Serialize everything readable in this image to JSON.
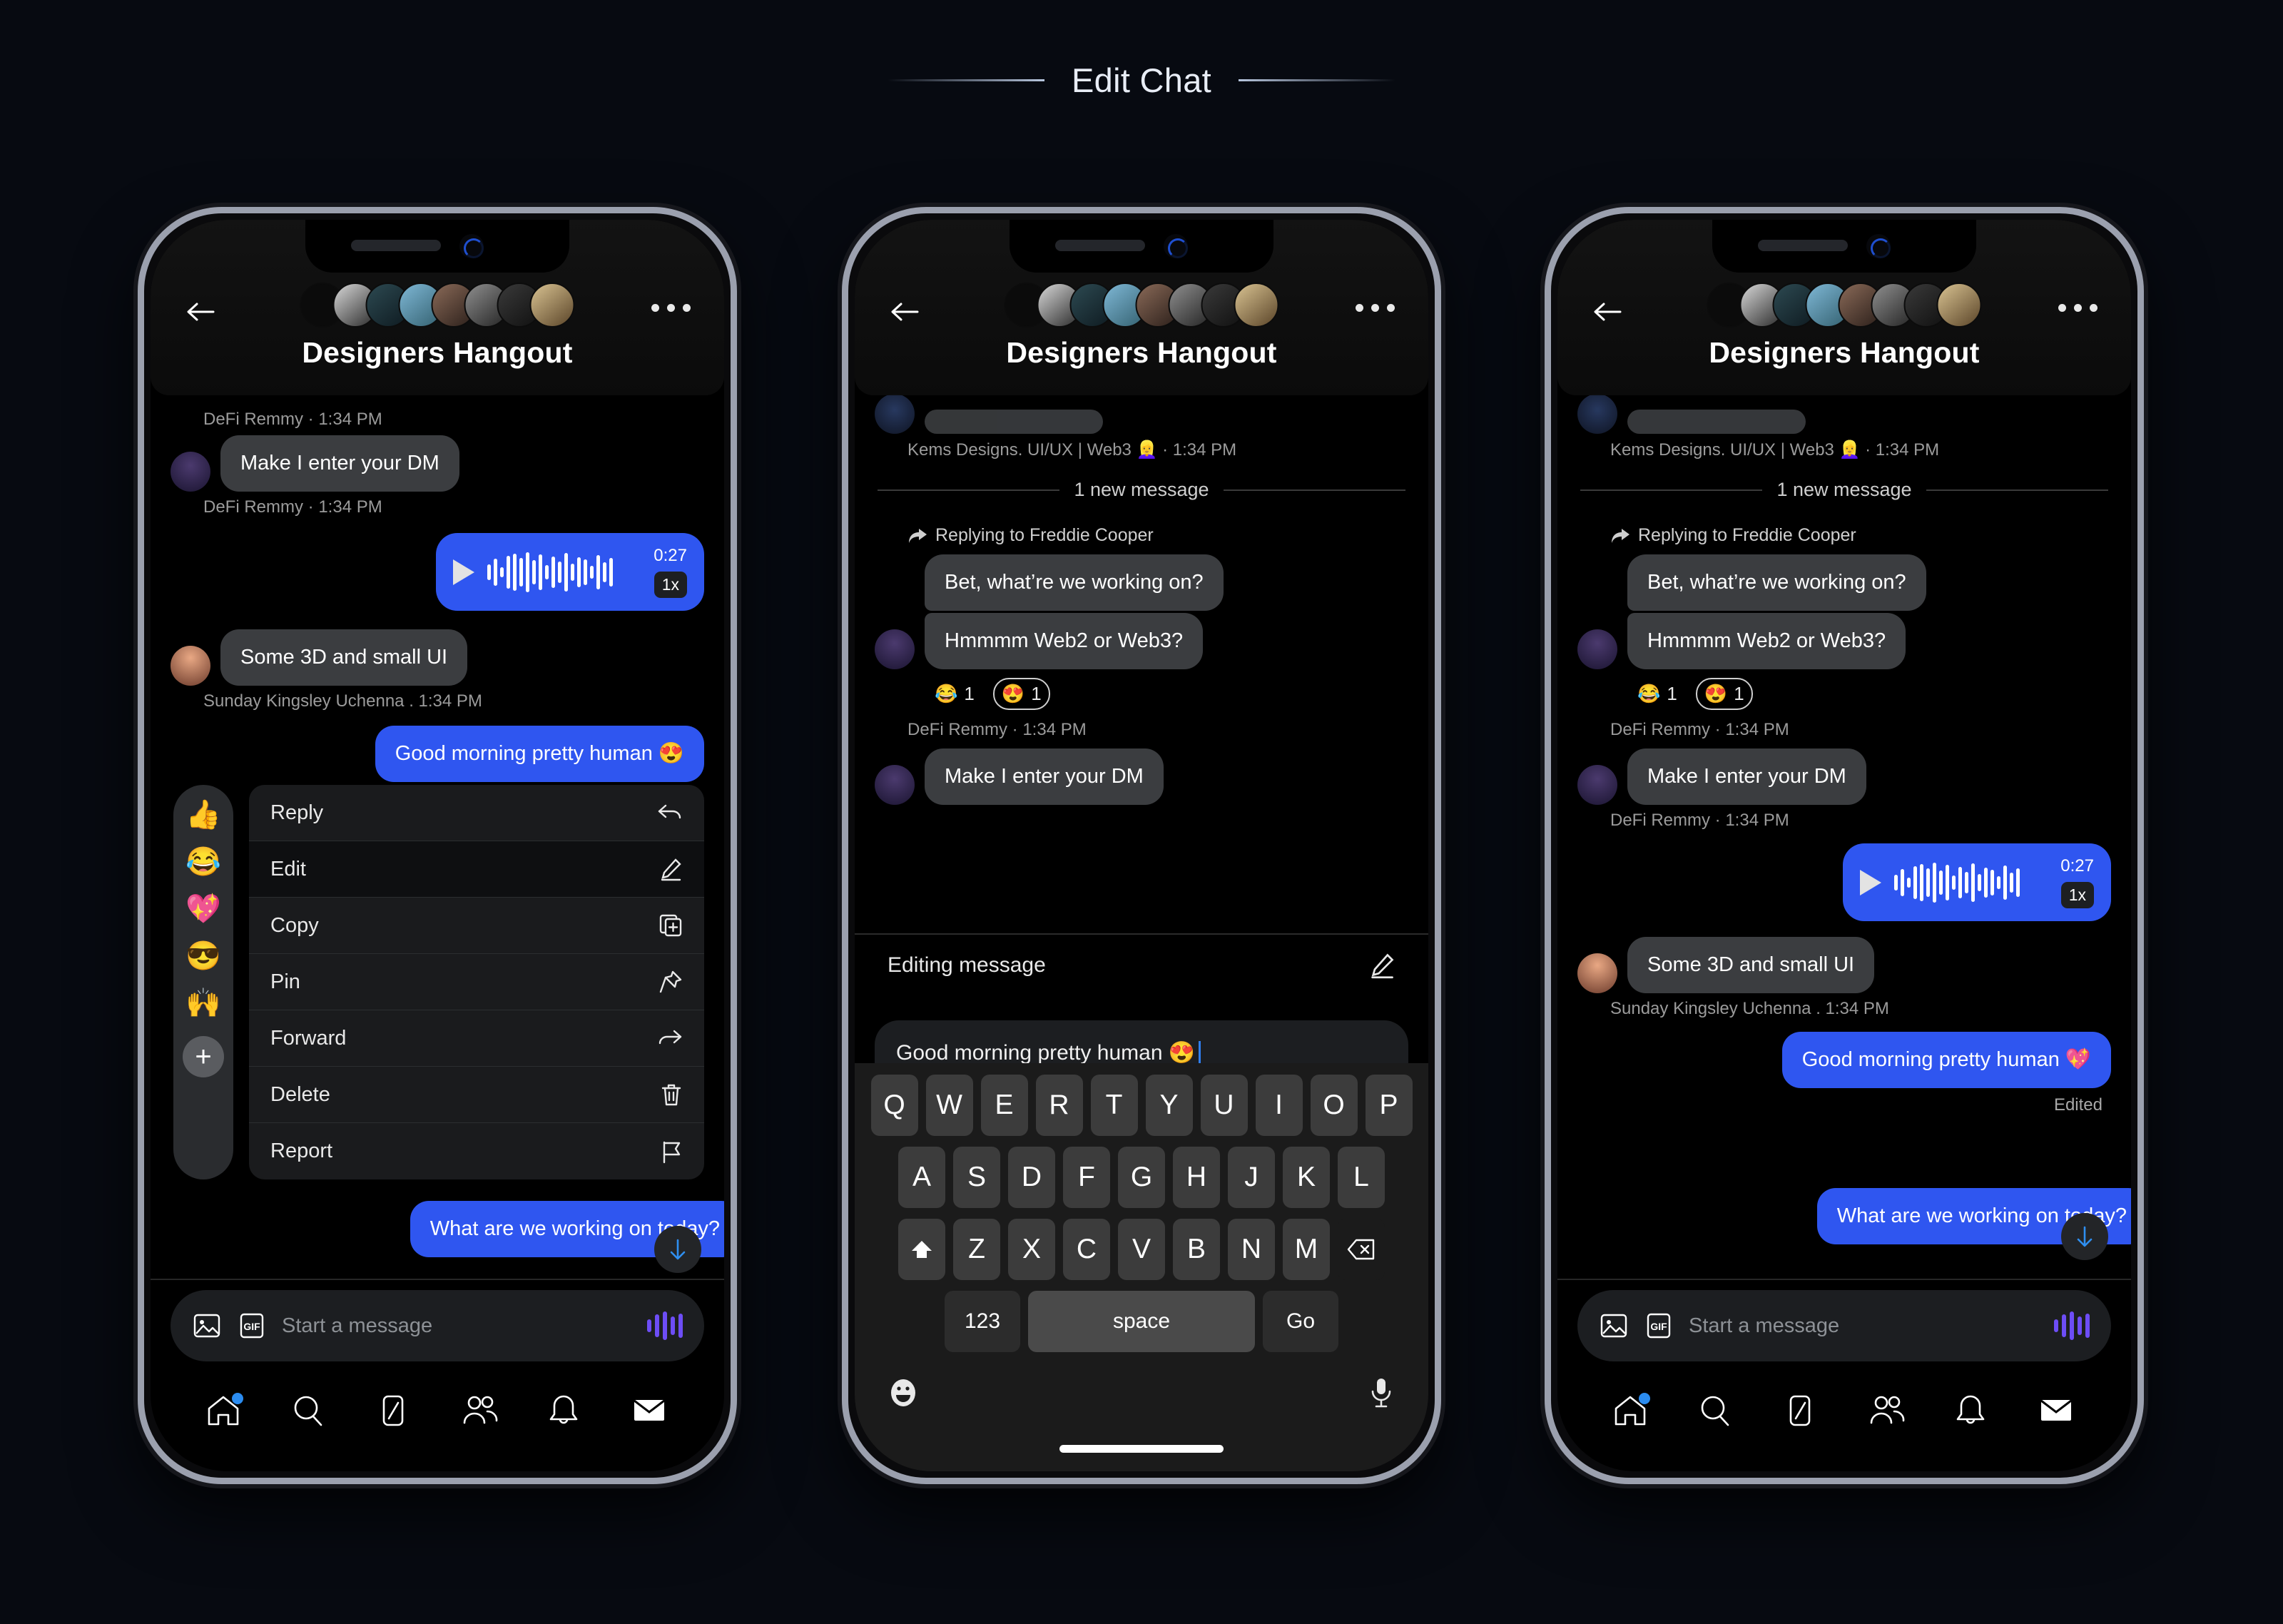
{
  "page": {
    "title": "Edit Chat"
  },
  "chat": {
    "title": "Designers Hangout",
    "avatar_count": 8,
    "accent_blue": "#2f56f0",
    "bubble_gray": "#3b3d40",
    "background": "#000000",
    "page_background": "#070a11"
  },
  "phone1": {
    "meta_top": "DeFi Remmy  · 1:34 PM",
    "msg_dm": "Make I enter your DM",
    "meta_dm": "DeFi Remmy · 1:34 PM",
    "voice": {
      "time": "0:27",
      "speed": "1x"
    },
    "msg_3d": "Some 3D and small UI",
    "meta_3d": "Sunday Kingsley Uchenna . 1:34 PM",
    "msg_greeting": "Good morning pretty human 😍",
    "msg_working": "What are we working on today?",
    "reactions": [
      "👍",
      "😂",
      "💖",
      "😎",
      "🙌"
    ],
    "add_reaction": "+",
    "menu": [
      {
        "label": "Reply",
        "icon": "reply-icon",
        "active": false
      },
      {
        "label": "Edit",
        "icon": "pencil-icon",
        "active": true
      },
      {
        "label": "Copy",
        "icon": "copy-icon",
        "active": false
      },
      {
        "label": "Pin",
        "icon": "pin-icon",
        "active": false
      },
      {
        "label": "Forward",
        "icon": "forward-icon",
        "active": false
      },
      {
        "label": "Delete",
        "icon": "trash-icon",
        "active": false
      },
      {
        "label": "Report",
        "icon": "flag-icon",
        "active": false
      }
    ],
    "composer_placeholder": "Start a message",
    "nav": [
      "home-icon",
      "search-icon",
      "compose-icon",
      "people-icon",
      "bell-icon",
      "mail-icon"
    ]
  },
  "phone2": {
    "meta_kems": "Kems Designs. UI/UX | Web3 👱‍♀️ · 1:34 PM",
    "new_message_label": "1 new message",
    "replying_to": "Replying to Freddie Cooper",
    "msg_bet": "Bet, what’re we working on?",
    "msg_hmm": "Hmmmm Web2 or Web3?",
    "reactions": [
      {
        "emoji": "😂",
        "count": "1",
        "owned": false
      },
      {
        "emoji": "😍",
        "count": "1",
        "owned": true
      }
    ],
    "meta_remmy": "DeFi Remmy · 1:34 PM",
    "msg_dm": "Make I enter your DM",
    "editing_label": "Editing message",
    "editing_value": "Good morning pretty human 😍",
    "keyboard": {
      "row1": [
        "Q",
        "W",
        "E",
        "R",
        "T",
        "Y",
        "U",
        "I",
        "O",
        "P"
      ],
      "row2": [
        "A",
        "S",
        "D",
        "F",
        "G",
        "H",
        "J",
        "K",
        "L"
      ],
      "row3": [
        "Z",
        "X",
        "C",
        "V",
        "B",
        "N",
        "M"
      ],
      "numbers_key": "123",
      "space_key": "space",
      "go_key": "Go"
    }
  },
  "phone3": {
    "meta_kems": "Kems Designs. UI/UX | Web3 👱‍♀️ · 1:34 PM",
    "new_message_label": "1 new message",
    "replying_to": "Replying to Freddie Cooper",
    "msg_bet": "Bet, what’re we working on?",
    "msg_hmm": "Hmmmm Web2 or Web3?",
    "reactions": [
      {
        "emoji": "😂",
        "count": "1",
        "owned": false
      },
      {
        "emoji": "😍",
        "count": "1",
        "owned": true
      }
    ],
    "meta_remmy_a": "DeFi Remmy · 1:34 PM",
    "msg_dm": "Make I enter your DM",
    "meta_remmy_b": "DeFi Remmy · 1:34 PM",
    "voice": {
      "time": "0:27",
      "speed": "1x"
    },
    "msg_3d": "Some 3D and small UI",
    "meta_3d": "Sunday Kingsley Uchenna . 1:34 PM",
    "msg_greeting_edited": "Good morning pretty human 💖",
    "edited_tag": "Edited",
    "msg_working": "What are we working on today?",
    "composer_placeholder": "Start a message",
    "nav": [
      "home-icon",
      "search-icon",
      "compose-icon",
      "people-icon",
      "bell-icon",
      "mail-icon"
    ]
  }
}
